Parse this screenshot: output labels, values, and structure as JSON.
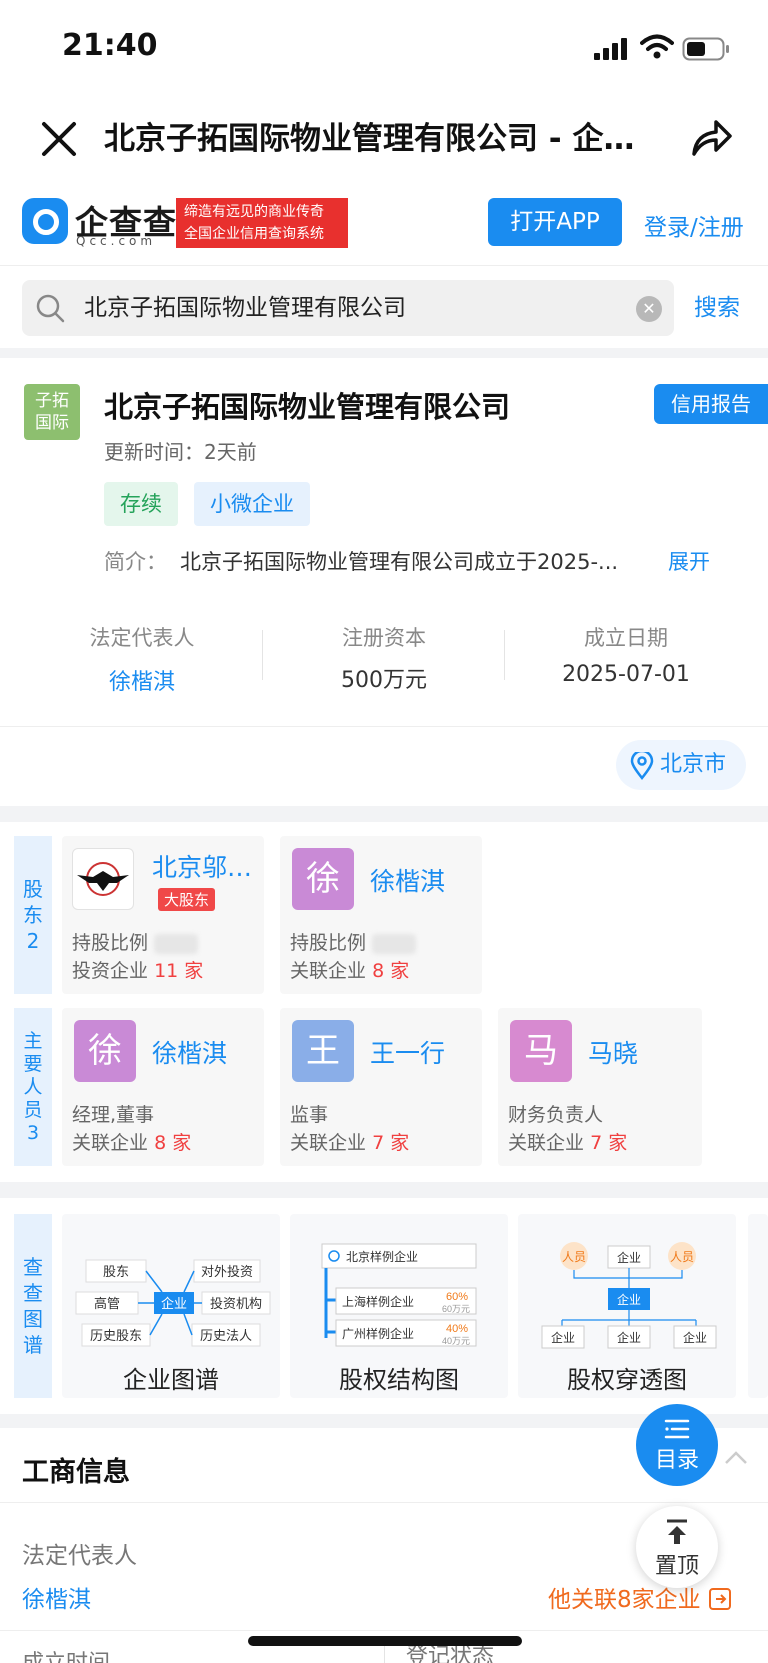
{
  "status_bar": {
    "time": "21:40"
  },
  "nav": {
    "title": "北京子拓国际物业管理有限公司 - 企查查"
  },
  "qcc": {
    "logo_text": "企查查",
    "logo_sub": "Qcc.com",
    "slogan_line1": "缔造有远见的商业传奇",
    "slogan_line2": "全国企业信用查询系统",
    "open_app": "打开APP",
    "login": "登录/注册"
  },
  "search": {
    "value": "北京子拓国际物业管理有限公司",
    "button": "搜索"
  },
  "company": {
    "logo_line1": "子拓",
    "logo_line2": "国际",
    "name": "北京子拓国际物业管理有限公司",
    "credit_report": "信用报告",
    "update_time": "更新时间：2天前",
    "tags": [
      "存续",
      "小微企业"
    ],
    "intro_label": "简介：",
    "intro_text": "北京子拓国际物业管理有限公司成立于2025-...",
    "intro_more": "展开",
    "legal_rep_label": "法定代表人",
    "legal_rep": "徐楷淇",
    "capital_label": "注册资本",
    "capital": "500万元",
    "founded_label": "成立日期",
    "founded": "2025-07-01",
    "location": "北京市"
  },
  "shareholders": {
    "side_label": [
      "股",
      "东",
      "2"
    ],
    "items": [
      {
        "name": "北京邬…",
        "badge": "大股东",
        "ratio_label": "持股比例",
        "line2_label": "投资企业",
        "line2_count": "11",
        "line2_unit": "家"
      },
      {
        "avatar": "徐",
        "name": "徐楷淇",
        "ratio_label": "持股比例",
        "line2_label": "关联企业",
        "line2_count": "8",
        "line2_unit": "家",
        "color": "#c98ad6"
      }
    ]
  },
  "staff": {
    "side_label": [
      "主",
      "要",
      "人",
      "员",
      "3"
    ],
    "items": [
      {
        "avatar": "徐",
        "name": "徐楷淇",
        "role": "经理,董事",
        "line2_label": "关联企业",
        "line2_count": "8",
        "line2_unit": "家",
        "color": "#c98ad6"
      },
      {
        "avatar": "王",
        "name": "王一行",
        "role": "监事",
        "line2_label": "关联企业",
        "line2_count": "7",
        "line2_unit": "家",
        "color": "#8aaee8"
      },
      {
        "avatar": "马",
        "name": "马晓",
        "role": "财务负责人",
        "line2_label": "关联企业",
        "line2_count": "7",
        "line2_unit": "家",
        "color": "#d78ad0"
      }
    ]
  },
  "graphs": {
    "side_label": [
      "查",
      "查",
      "图",
      "谱"
    ],
    "items": [
      {
        "label": "企业图谱",
        "nodes": [
          "股东",
          "对外投资",
          "高管",
          "企业",
          "投资机构",
          "历史股东",
          "历史法人"
        ]
      },
      {
        "label": "股权结构图",
        "nodes": [
          "北京样例企业",
          "上海样例企业",
          "60%",
          "60万元",
          "广州样例企业",
          "40%",
          "40万元"
        ]
      },
      {
        "label": "股权穿透图",
        "nodes": [
          "人员",
          "企业",
          "人员",
          "企业",
          "企业",
          "企业",
          "企业"
        ]
      }
    ]
  },
  "business": {
    "title": "工商信息",
    "legal_rep_label": "法定代表人",
    "legal_rep": "徐楷淇",
    "related": "他关联8家企业",
    "founded_label": "成立时间",
    "status_label": "登记状态"
  },
  "fab": {
    "menu": "目录",
    "top": "置顶"
  },
  "colors": {
    "accent": "#1a8cf0",
    "red": "#f04040",
    "orange": "#f06a1e",
    "green": "#24a35a"
  }
}
